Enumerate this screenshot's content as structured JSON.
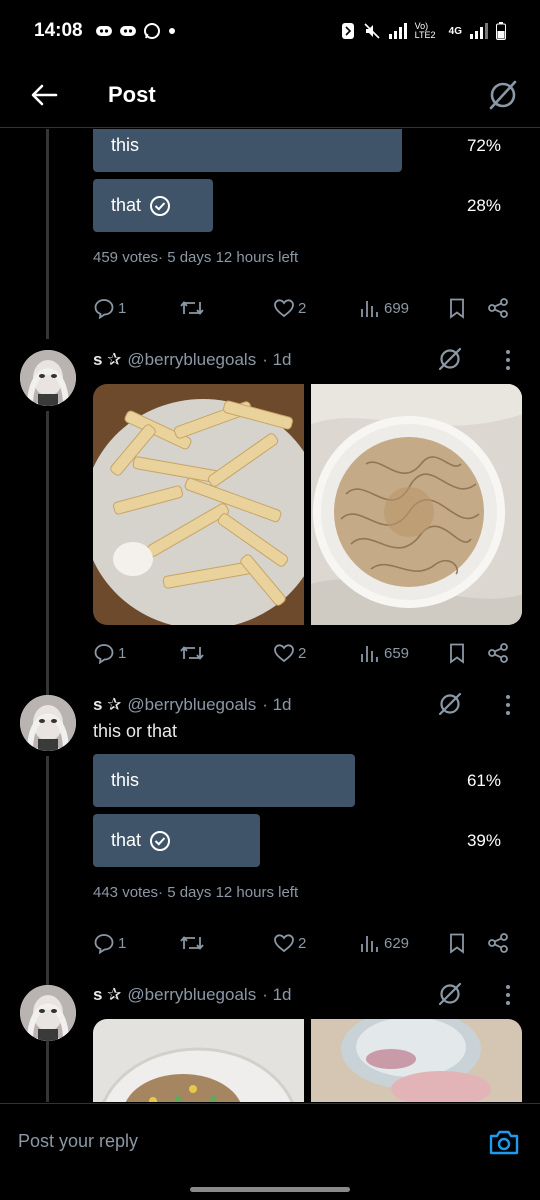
{
  "status_bar": {
    "time": "14:08",
    "network": "4G",
    "lte": "Vo) LTE2"
  },
  "header": {
    "title": "Post"
  },
  "posts": [
    {
      "poll": {
        "options": [
          {
            "label": "this",
            "percent": "72%",
            "fill": 0.72,
            "selected": false
          },
          {
            "label": "that",
            "percent": "28%",
            "fill": 0.28,
            "selected": true
          }
        ],
        "meta": "459 votes· 5 days 12 hours left"
      },
      "actions": {
        "replies": "1",
        "reposts": "",
        "likes": "2",
        "views": "699"
      }
    },
    {
      "author_name": "s ✰",
      "handle": "@berrybluegoals",
      "time": "· 1d",
      "media": [
        "fries-photo",
        "noodles-photo"
      ],
      "actions": {
        "replies": "1",
        "reposts": "",
        "likes": "2",
        "views": "659"
      }
    },
    {
      "author_name": "s ✰",
      "handle": "@berrybluegoals",
      "time": "· 1d",
      "text": "this or that",
      "poll": {
        "options": [
          {
            "label": "this",
            "percent": "61%",
            "fill": 0.61,
            "selected": false
          },
          {
            "label": "that",
            "percent": "39%",
            "fill": 0.39,
            "selected": true
          }
        ],
        "meta": "443 votes· 5 days 12 hours left"
      },
      "actions": {
        "replies": "1",
        "reposts": "",
        "likes": "2",
        "views": "629"
      }
    },
    {
      "author_name": "s ✰",
      "handle": "@berrybluegoals",
      "time": "· 1d",
      "media": [
        "rice-bowl-photo",
        "dessert-photo"
      ]
    }
  ],
  "reply": {
    "placeholder": "Post your reply"
  },
  "colors": {
    "poll_fill": "#3f5468",
    "accent": "#1d9bf0",
    "muted": "#8b98a5",
    "background": "#000000"
  },
  "icons": [
    "back-arrow-icon",
    "grok-icon",
    "reply-icon",
    "repost-icon",
    "like-icon",
    "views-icon",
    "bookmark-icon",
    "share-icon",
    "more-icon",
    "camera-icon"
  ]
}
